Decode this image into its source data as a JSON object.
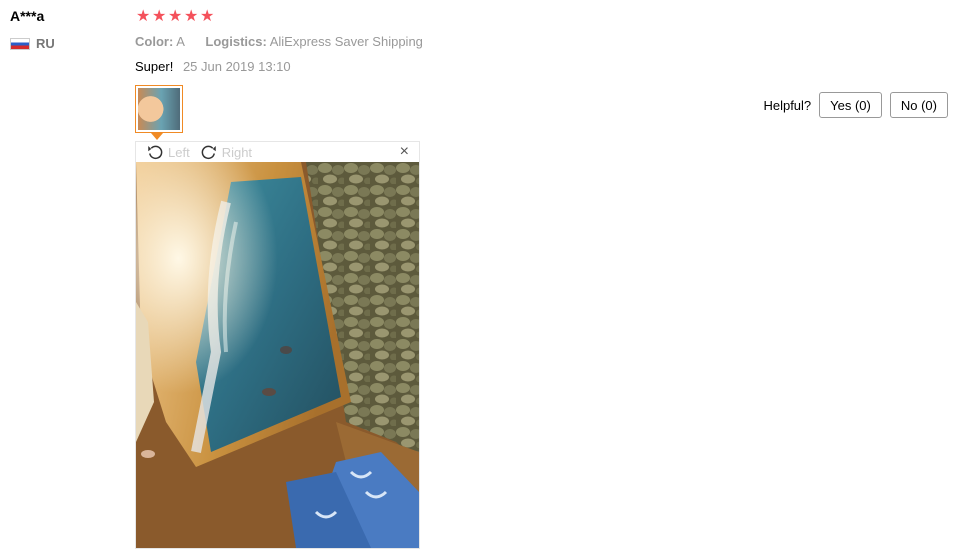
{
  "review": {
    "user_name": "A***a",
    "country_code": "RU",
    "rating_stars": 5,
    "color_label": "Color:",
    "color_value": "A",
    "logistics_label": "Logistics:",
    "logistics_value": "AliExpress Saver Shipping",
    "feedback_text": "Super!",
    "date": "25 Jun 2019 13:10"
  },
  "helpful": {
    "label": "Helpful?",
    "yes_label": "Yes (0)",
    "no_label": "No (0)"
  },
  "viewer": {
    "rotate_left_label": "Left",
    "rotate_right_label": "Right",
    "close_label": "×"
  },
  "colors": {
    "star": "#f4515b",
    "accent_border": "#f08a24",
    "muted_text": "#999999"
  }
}
